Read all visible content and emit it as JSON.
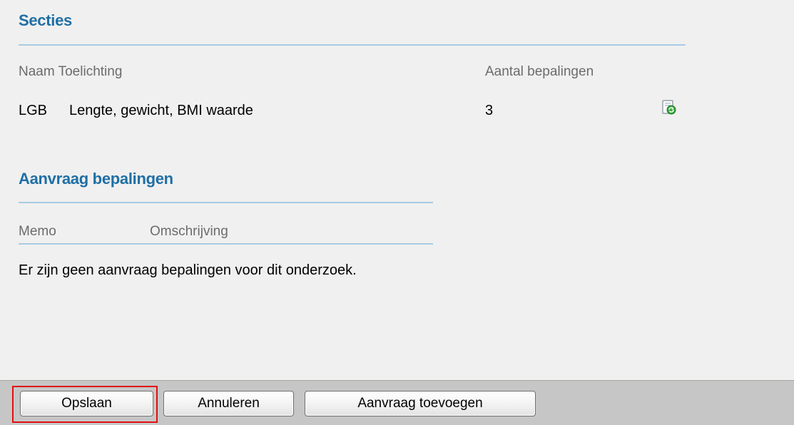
{
  "sections": {
    "title": "Secties",
    "headers": {
      "naam_toelichting": "Naam Toelichting",
      "aantal": "Aantal bepalingen"
    },
    "rows": [
      {
        "code": "LGB",
        "toelichting": "Lengte, gewicht, BMI waarde",
        "aantal": "3",
        "icon": "refresh-document-icon"
      }
    ]
  },
  "aanvraag": {
    "title": "Aanvraag bepalingen",
    "headers": {
      "memo": "Memo",
      "omschrijving": "Omschrijving"
    },
    "empty_message": "Er zijn geen aanvraag bepalingen voor dit onderzoek."
  },
  "footer": {
    "save_label": "Opslaan",
    "cancel_label": "Annuleren",
    "add_request_label": "Aanvraag toevoegen"
  },
  "colors": {
    "section_title": "#1f6fa5",
    "rule": "#a9cbe3",
    "focus_outline": "#e01010",
    "footer_bg": "#c6c6c6"
  }
}
